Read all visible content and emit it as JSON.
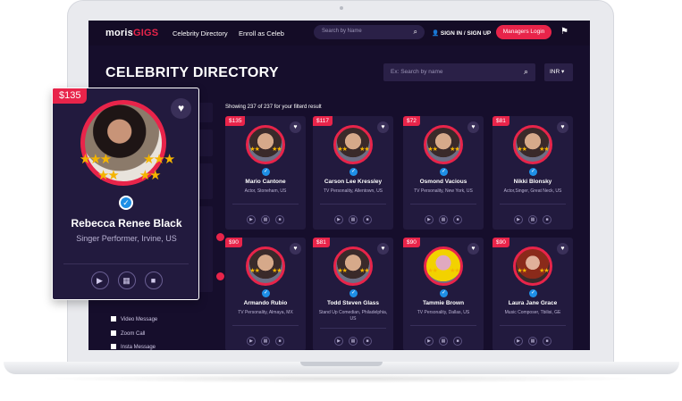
{
  "nav": {
    "logo_main": "moris",
    "logo_accent": "GIGS",
    "links": [
      "Celebrity Directory",
      "Enroll as Celeb"
    ],
    "search_placeholder": "Search by Name",
    "signin_label": "SIGN IN / SIGN UP",
    "managers_login": "Managers Login"
  },
  "header": {
    "title": "CELEBRITY DIRECTORY",
    "search_placeholder": "Ex: Search by name",
    "currency": "INR"
  },
  "results": {
    "showing": "Showing 237 of 237 for your filterd result"
  },
  "filters": {
    "options": [
      "Video Message",
      "Zoom Call",
      "Insta Message"
    ]
  },
  "featured": {
    "price": "$135",
    "name": "Rebecca Renee Black",
    "subtitle": "Singer Performer, Irvine, US"
  },
  "cards": [
    {
      "price": "$135",
      "name": "Mario Cantone",
      "sub": "Actor, Stoneham, US"
    },
    {
      "price": "$117",
      "name": "Carson Lee Kressley",
      "sub": "TV Personality, Allentown, US"
    },
    {
      "price": "$72",
      "name": "Osmond Vacious",
      "sub": "TV Personality, New York, US"
    },
    {
      "price": "$81",
      "name": "Nikki Blonsky",
      "sub": "Actor,Singer, Great Neck, US"
    },
    {
      "price": "$90",
      "name": "Armando Rubio",
      "sub": "TV Personality, Almaya, MX"
    },
    {
      "price": "$81",
      "name": "Todd Steven Glass",
      "sub": "Stand Up Comedian, Philadelphia, US"
    },
    {
      "price": "$90",
      "name": "Tammie Brown",
      "sub": "TV Personality, Dallas, US"
    },
    {
      "price": "$90",
      "name": "Laura Jane Grace",
      "sub": "Music Composer, Tbilisi, GE"
    }
  ],
  "icons": {
    "verified": "check-badge-icon",
    "heart": "heart-icon",
    "play": "play-icon",
    "calendar": "calendar-icon",
    "video": "video-icon",
    "star": "star-icon"
  },
  "colors": {
    "accent": "#e8244a",
    "background": "#160e2c",
    "card": "#221a3e",
    "star": "#f4b400",
    "verified": "#1e8fe6"
  }
}
